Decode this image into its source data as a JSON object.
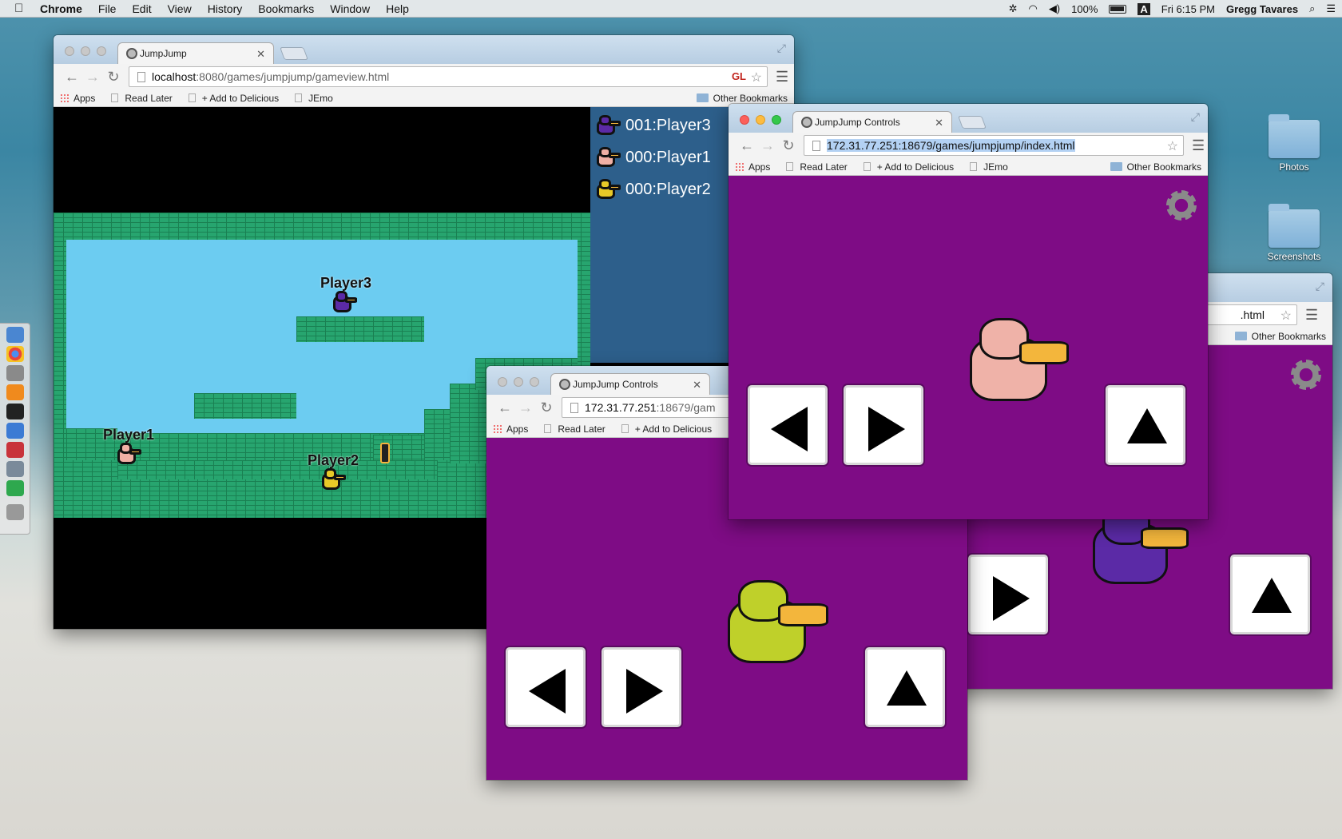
{
  "menubar": {
    "app": "Chrome",
    "items": [
      "File",
      "Edit",
      "View",
      "History",
      "Bookmarks",
      "Window",
      "Help"
    ],
    "battery": "100%",
    "input_source": "A",
    "clock": "Fri 6:15 PM",
    "user": "Gregg Tavares"
  },
  "desktop": {
    "icons": [
      {
        "label": "Photos"
      },
      {
        "label": "Screenshots"
      }
    ]
  },
  "bookmarks_bar": {
    "apps": "Apps",
    "read_later": "Read Later",
    "add_delicious": "+ Add to Delicious",
    "jemo": "JEmo",
    "other": "Other Bookmarks"
  },
  "game_window": {
    "tab_title": "JumpJump",
    "url_host": "localhost",
    "url_path": ":8080/games/jumpjump/gameview.html",
    "gl_badge": "GL",
    "players": [
      {
        "label": "Player3",
        "color": "#5b2aa6"
      },
      {
        "label": "Player1",
        "color": "#f0b0a5"
      },
      {
        "label": "Player2",
        "color": "#e8c928"
      }
    ],
    "scoreboard": [
      "001:Player3",
      "000:Player1",
      "000:Player2"
    ],
    "colors": {
      "sky": "#6cccf1",
      "brick": "#27a56f",
      "scoreboard_bg": "#2d5f8b"
    }
  },
  "controller_front": {
    "tab_title": "JumpJump Controls",
    "url_host": "172.31.77.251",
    "url_path": ":18679/games/jumpjump/index.html",
    "bird_color": "#efb2a8"
  },
  "controller_back_right": {
    "url_tail": ".html",
    "bird_color": "#5b2aa6"
  },
  "controller_left": {
    "tab_title": "JumpJump Controls",
    "url_host": "172.31.77.251",
    "url_path": ":18679/gam",
    "bird_color": "#bfd02a"
  },
  "controls": {
    "left": "left-arrow",
    "right": "right-arrow",
    "jump": "up-arrow",
    "settings": "gear-icon",
    "bg_color": "#7e0c85"
  }
}
